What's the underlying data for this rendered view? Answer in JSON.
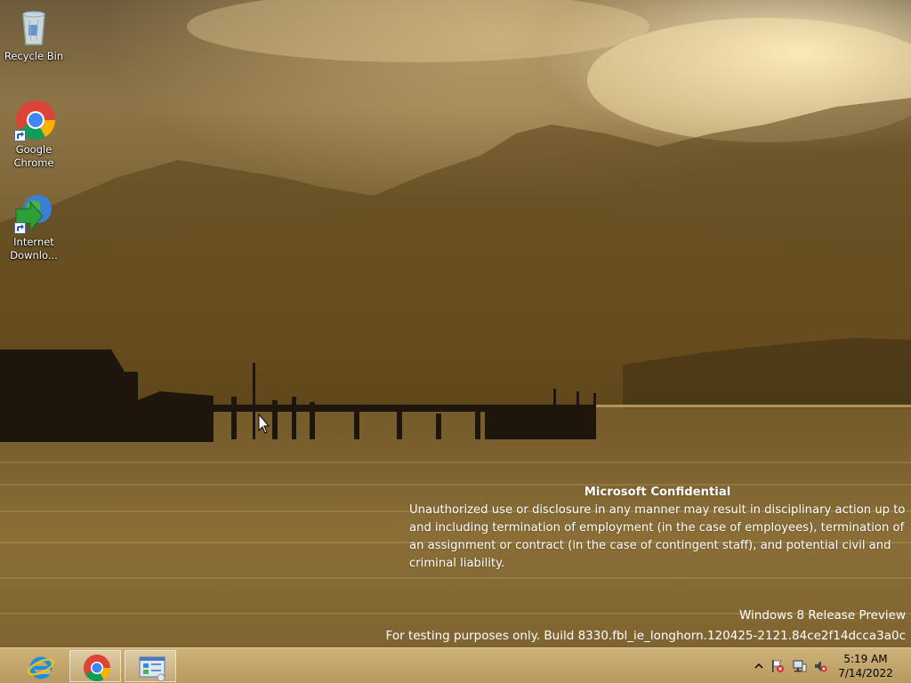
{
  "desktop": {
    "icons": [
      {
        "label": "Recycle Bin"
      },
      {
        "label": "Google Chrome"
      },
      {
        "label": "Internet Downlo..."
      }
    ]
  },
  "watermark": {
    "title": "Microsoft Confidential",
    "body": "Unauthorized use or disclosure in any manner may result in disciplinary action up to and including termination of employment (in the case of employees), termination of an assignment or contract (in the case of contingent staff), and potential civil and criminal liability.",
    "edition": "Windows 8 Release Preview",
    "build": "For testing purposes only. Build 8330.fbl_ie_longhorn.120425-2121.84ce2f14dcca3a0c"
  },
  "taskbar": {
    "pinned": [
      {
        "name": "internet-explorer",
        "icon": "ie-icon"
      },
      {
        "name": "google-chrome",
        "icon": "chrome-icon"
      },
      {
        "name": "control-panel",
        "icon": "control-panel-icon"
      }
    ],
    "tray_icons": [
      "show-hidden-icons-chevron",
      "action-center-flag-icon",
      "network-icon",
      "volume-muted-icon"
    ],
    "clock": {
      "time": "5:19 AM",
      "date": "7/14/2022"
    }
  },
  "colors": {
    "taskbar_top": "#cdb27a",
    "taskbar_bottom": "#b89a5f"
  }
}
